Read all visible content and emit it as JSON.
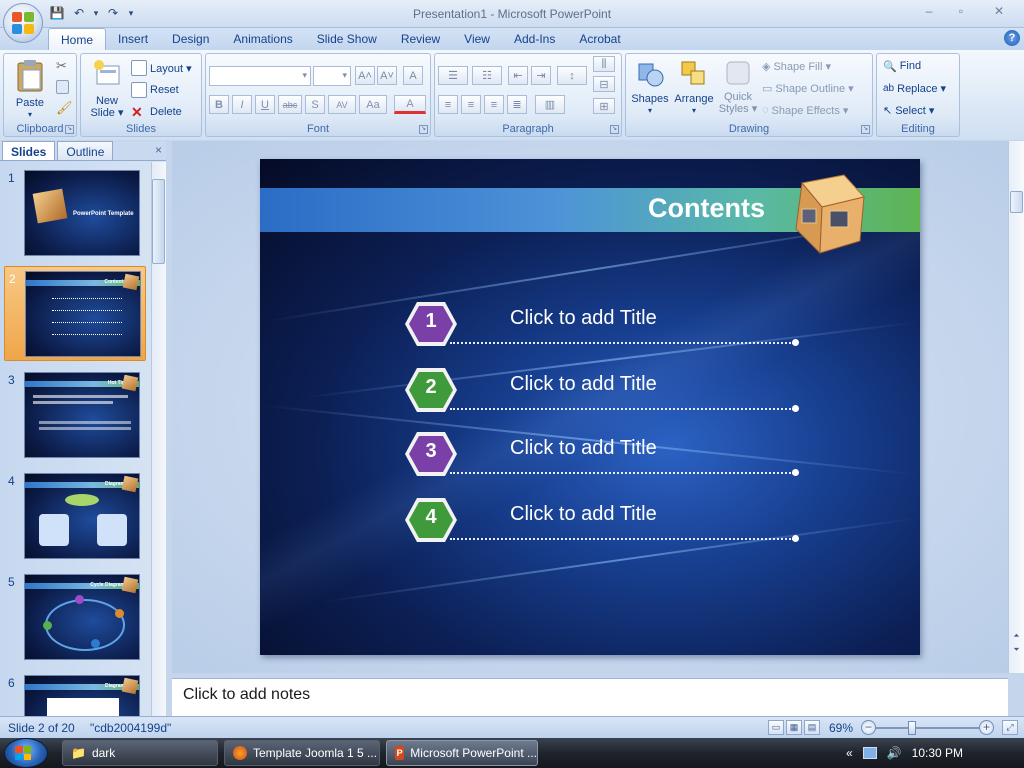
{
  "window": {
    "title": "Presentation1 - Microsoft PowerPoint",
    "minimize": "–",
    "restore": "▫",
    "close": "✕"
  },
  "qat": {
    "save": "💾",
    "undo": "↶",
    "undo_more": "▾",
    "redo": "↷",
    "customize": "▾"
  },
  "tabs": [
    "Home",
    "Insert",
    "Design",
    "Animations",
    "Slide Show",
    "Review",
    "View",
    "Add-Ins",
    "Acrobat"
  ],
  "active_tab": "Home",
  "help": "?",
  "ribbon": {
    "clipboard": {
      "label": "Clipboard",
      "paste": "Paste"
    },
    "slides": {
      "label": "Slides",
      "new_slide_1": "New",
      "new_slide_2": "Slide ▾",
      "layout": "Layout ▾",
      "reset": "Reset",
      "delete": "Delete"
    },
    "font": {
      "label": "Font",
      "grow": "A˄",
      "shrink": "A˅",
      "clear": "A",
      "bold": "B",
      "italic": "I",
      "underline": "U",
      "strike": "abc",
      "shadow": "S",
      "spacing": "AV",
      "case": "Aa",
      "color": "A"
    },
    "paragraph": {
      "label": "Paragraph"
    },
    "drawing": {
      "label": "Drawing",
      "shapes": "Shapes",
      "arrange": "Arrange",
      "quick_styles_1": "Quick",
      "quick_styles_2": "Styles ▾",
      "shape_fill": "Shape Fill ▾",
      "shape_outline": "Shape Outline ▾",
      "shape_effects": "Shape Effects ▾"
    },
    "editing": {
      "label": "Editing",
      "find": "Find",
      "replace": "Replace ▾",
      "select": "Select ▾"
    }
  },
  "pane": {
    "tab_slides": "Slides",
    "tab_outline": "Outline",
    "close": "×",
    "thumbnails": [
      {
        "num": "1",
        "title": "PowerPoint Template"
      },
      {
        "num": "2",
        "title": "Contents"
      },
      {
        "num": "3",
        "title": "Hot Tip"
      },
      {
        "num": "4",
        "title": "Diagram"
      },
      {
        "num": "5",
        "title": "Cycle Diagram"
      },
      {
        "num": "6",
        "title": "Diagram"
      }
    ],
    "selected": 2
  },
  "slide": {
    "title": "Contents",
    "items": [
      {
        "num": "1",
        "text": "Click to add Title",
        "color": "purple"
      },
      {
        "num": "2",
        "text": "Click to add Title",
        "color": "green"
      },
      {
        "num": "3",
        "text": "Click to add Title",
        "color": "purple"
      },
      {
        "num": "4",
        "text": "Click to add Title",
        "color": "green"
      }
    ]
  },
  "notes": {
    "placeholder": "Click to add notes"
  },
  "status": {
    "slide_info": "Slide 2 of 20",
    "theme": "\"cdb2004199d\"",
    "zoom": "69%",
    "zoom_level": 0.35
  },
  "taskbar": {
    "items": [
      {
        "label": "dark",
        "active": false
      },
      {
        "label": "Template Joomla 1 5 ...",
        "active": false
      },
      {
        "label": "Microsoft PowerPoint ...",
        "active": true
      }
    ],
    "clock": "10:30 PM"
  },
  "colors": {
    "purple": "#7b3fa8",
    "green": "#3f9a3c",
    "accent": "#15428b"
  }
}
